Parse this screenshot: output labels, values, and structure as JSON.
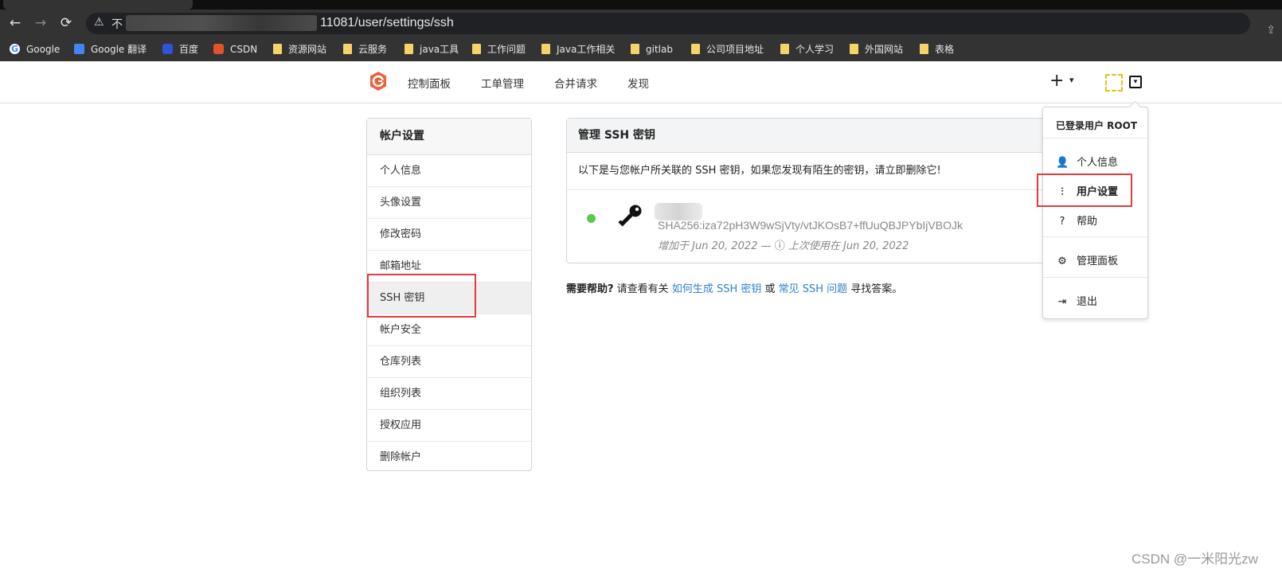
{
  "browser": {
    "url": "11081/user/settings/ssh",
    "not_secure_label": "不",
    "back_glyph": "←",
    "forward_glyph": "→",
    "reload_glyph": "⟳",
    "warning_glyph": "⚠",
    "share_glyph": "⇪",
    "bookmarks": [
      {
        "label": "Google",
        "icon": "google-icon"
      },
      {
        "label": "Google 翻译",
        "icon": "google-translate-icon"
      },
      {
        "label": "百度",
        "icon": "baidu-icon"
      },
      {
        "label": "CSDN",
        "icon": "csdn-icon"
      },
      {
        "label": "资源网站",
        "icon": "folder-icon"
      },
      {
        "label": "云服务",
        "icon": "folder-icon"
      },
      {
        "label": "java工具",
        "icon": "folder-icon"
      },
      {
        "label": "工作问题",
        "icon": "folder-icon"
      },
      {
        "label": "Java工作相关",
        "icon": "folder-icon"
      },
      {
        "label": "gitlab",
        "icon": "folder-icon"
      },
      {
        "label": "公司项目地址",
        "icon": "folder-icon"
      },
      {
        "label": "个人学习",
        "icon": "folder-icon"
      },
      {
        "label": "外国网站",
        "icon": "folder-icon"
      },
      {
        "label": "表格",
        "icon": "folder-icon"
      }
    ]
  },
  "nav": {
    "links": [
      "控制面板",
      "工单管理",
      "合并请求",
      "发现"
    ],
    "plus": "+",
    "caret": "▾",
    "avatar_caret": "▾"
  },
  "sidebar": {
    "title": "帐户设置",
    "items": [
      "个人信息",
      "头像设置",
      "修改密码",
      "邮箱地址",
      "SSH 密钥",
      "帐户安全",
      "仓库列表",
      "组织列表",
      "授权应用",
      "删除帐户"
    ],
    "active_index": 4
  },
  "panel": {
    "title": "管理 SSH 密钥",
    "description": "以下是与您帐户所关联的 SSH 密钥，如果您发现有陌生的密钥，请立即删除它!",
    "key": {
      "fingerprint": "SHA256:iza72pH3W9wSjVty/vtJKOsB7+ffUuQBJPYbIjVBOJk",
      "added": "增加于 Jun 20, 2022 — ",
      "clock_glyph": "ⓘ",
      "last_used": " 上次使用在 Jun 20, 2022",
      "status_color": "#5cc84d"
    }
  },
  "help": {
    "lead": "需要帮助?",
    "text1": " 请查看有关 ",
    "link1": "如何生成 SSH 密钥",
    "text2": " 或 ",
    "link2": "常见 SSH 问题",
    "text3": " 寻找答案。"
  },
  "user_menu": {
    "header": "已登录用户 ROOT",
    "items": [
      {
        "label": "个人信息",
        "icon": "user-icon",
        "glyph": "👤"
      },
      {
        "label": "用户设置",
        "icon": "settings-sliders-icon",
        "glyph": "⫶"
      },
      {
        "label": "帮助",
        "icon": "help-icon",
        "glyph": "?"
      },
      {
        "label": "管理面板",
        "icon": "server-gears-icon",
        "glyph": "⚙"
      },
      {
        "label": "退出",
        "icon": "sign-out-icon",
        "glyph": "⇥"
      }
    ]
  },
  "watermark": "CSDN @一米阳光zw",
  "colors": {
    "highlight": "#e23b3b",
    "link": "#2f7fd1",
    "logo": "#e8623a"
  }
}
